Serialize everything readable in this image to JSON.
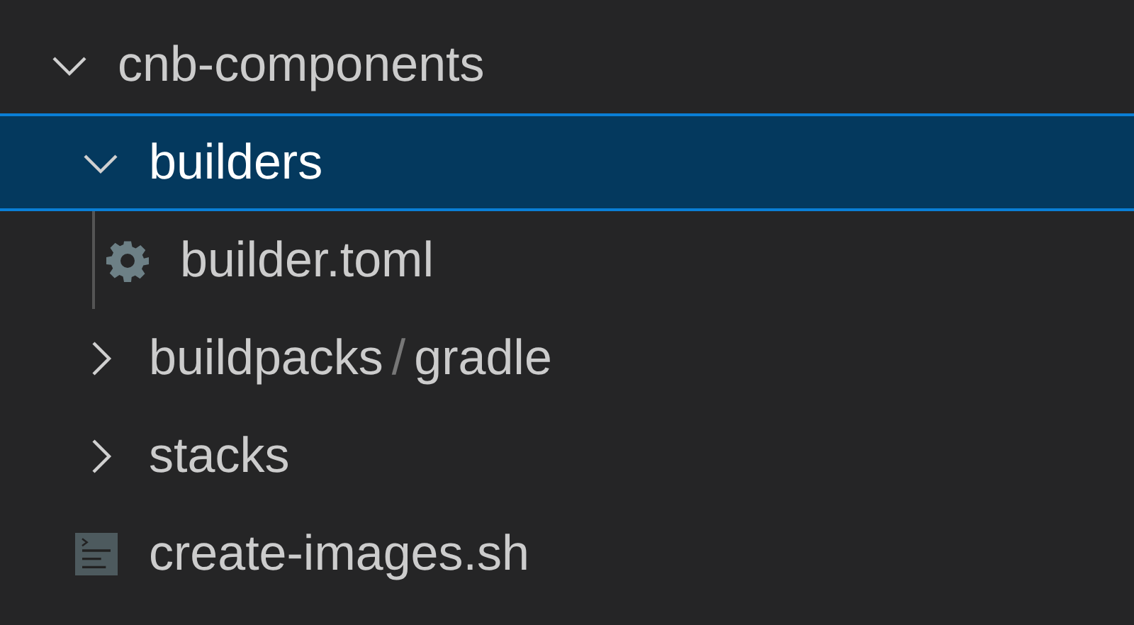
{
  "explorer": {
    "tree": [
      {
        "kind": "folder",
        "label": "cnb-components",
        "expanded": true,
        "selected": false,
        "children": [
          {
            "kind": "folder",
            "label": "builders",
            "expanded": true,
            "selected": true,
            "children": [
              {
                "kind": "config-file",
                "label": "builder.toml",
                "selected": false
              }
            ]
          },
          {
            "kind": "compact-folder",
            "segments": [
              "buildpacks",
              "gradle"
            ],
            "separator": "/",
            "expanded": false,
            "selected": false
          },
          {
            "kind": "folder",
            "label": "stacks",
            "expanded": false,
            "selected": false
          },
          {
            "kind": "shell-file",
            "label": "create-images.sh",
            "selected": false
          }
        ]
      }
    ]
  }
}
